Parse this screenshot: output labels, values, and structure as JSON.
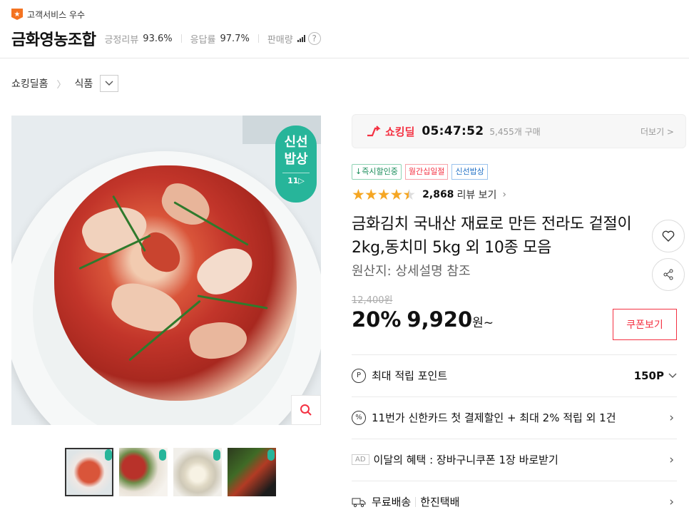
{
  "seller": {
    "badge_icon": "star-icon",
    "badge_text": "고객서비스 우수",
    "name": "금화영농조합",
    "positive_review_label": "긍정리뷰",
    "positive_review_value": "93.6%",
    "response_label": "응답률",
    "response_value": "97.7%",
    "sales_label": "판매량",
    "help": "?"
  },
  "breadcrumb": {
    "home": "쇼킹딜홈",
    "category": "식품"
  },
  "image": {
    "badge_line1": "신선",
    "badge_line2": "밥상",
    "badge_sub": "11▷",
    "thumb_count": 4
  },
  "deal": {
    "label": "쇼킹딜",
    "time": "05:47:52",
    "purchases": "5,455개 구매",
    "more": "더보기 >"
  },
  "tags": [
    "↓즉시할인중",
    "월간십일절",
    "신선밥상"
  ],
  "rating": {
    "stars": "★★★★★",
    "score": 4.5,
    "count": "2,868",
    "link": "리뷰 보기"
  },
  "product": {
    "title": "금화김치 국내산 재료로 만든 전라도 겉절이 2kg,동치미 5kg 외 10종 모음",
    "origin": "원산지: 상세설명 참조"
  },
  "price": {
    "original": "12,400원",
    "discount": "20%",
    "sale": "9,920",
    "unit": "원~",
    "coupon_button": "쿠폰보기"
  },
  "benefits": {
    "points_icon": "P",
    "points_label": "최대 적립 포인트",
    "points_value": "150P",
    "card_icon": "%",
    "card_label": "11번가 신한카드 첫 결제할인 + 최대 2% 적립 외 1건",
    "ad_tag": "AD",
    "monthly_label": "이달의 혜택 : 장바구니쿠폰 1장 바로받기",
    "shipping_label": "무료배송",
    "shipping_carrier": "한진택배"
  },
  "colors": {
    "accent_red": "#f43142",
    "fresh_green": "#27b59a",
    "star": "#f5a623",
    "badge_orange": "#f47321"
  }
}
